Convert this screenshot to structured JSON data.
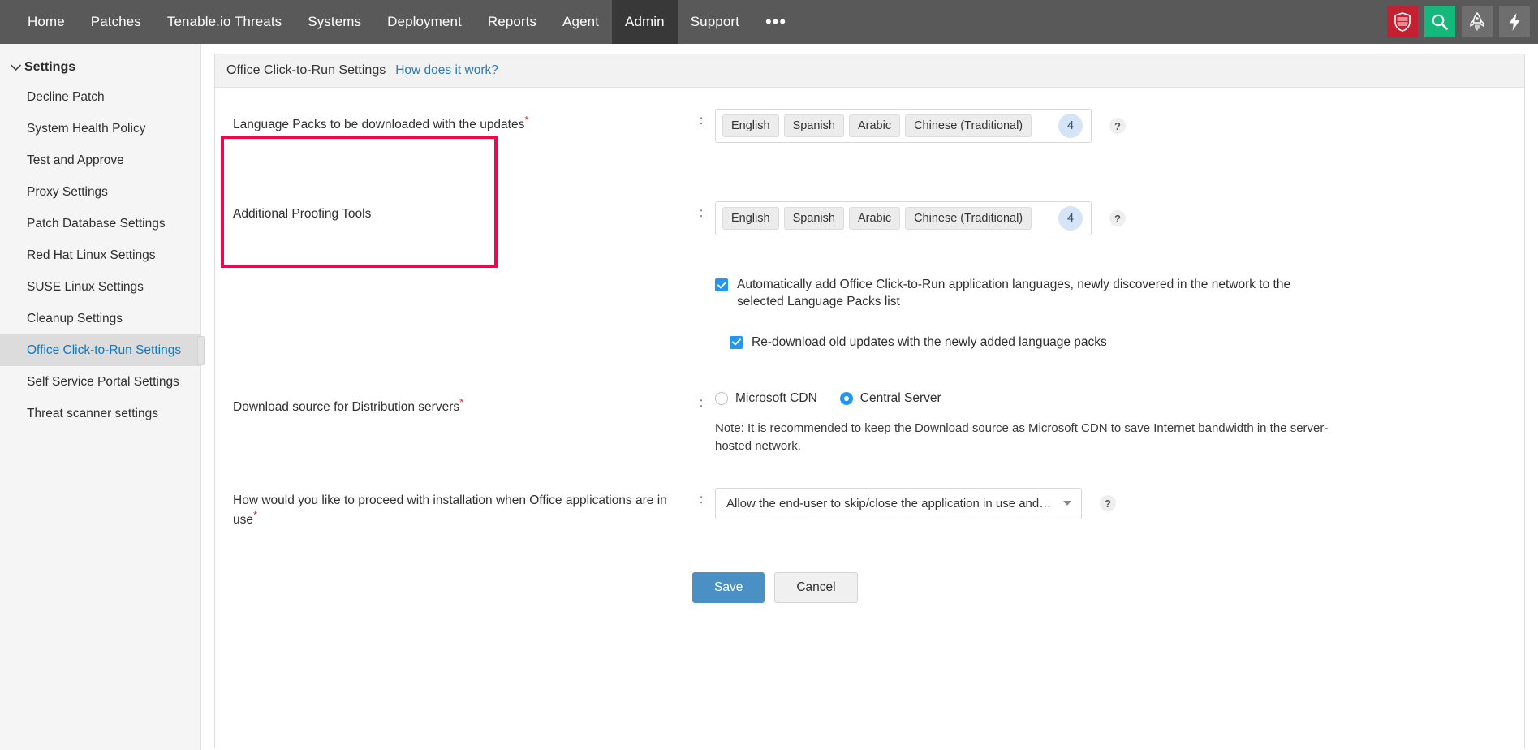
{
  "topnav": {
    "items": [
      {
        "label": "Home",
        "active": false
      },
      {
        "label": "Patches",
        "active": false
      },
      {
        "label": "Tenable.io Threats",
        "active": false
      },
      {
        "label": "Systems",
        "active": false
      },
      {
        "label": "Deployment",
        "active": false
      },
      {
        "label": "Reports",
        "active": false
      },
      {
        "label": "Agent",
        "active": false
      },
      {
        "label": "Admin",
        "active": true
      },
      {
        "label": "Support",
        "active": false
      }
    ],
    "more_label": "•••",
    "icons": [
      {
        "name": "shield-icon",
        "color": "#c42032"
      },
      {
        "name": "search-icon",
        "color": "#13b87a"
      },
      {
        "name": "rocket-icon",
        "color": "#6e6e6e"
      },
      {
        "name": "bolt-icon",
        "color": "#6e6e6e"
      }
    ]
  },
  "sidebar": {
    "header": "Settings",
    "items": [
      {
        "label": "Decline Patch"
      },
      {
        "label": "System Health Policy"
      },
      {
        "label": "Test and Approve"
      },
      {
        "label": "Proxy Settings"
      },
      {
        "label": "Patch Database Settings"
      },
      {
        "label": "Red Hat Linux Settings"
      },
      {
        "label": "SUSE Linux Settings"
      },
      {
        "label": "Cleanup Settings"
      },
      {
        "label": "Office Click-to-Run Settings"
      },
      {
        "label": "Self Service Portal Settings"
      },
      {
        "label": "Threat scanner settings"
      }
    ],
    "active_index": 8
  },
  "panel": {
    "title": "Office Click-to-Run Settings",
    "how_link": "How does it work?"
  },
  "form": {
    "colon": ":",
    "help_glyph": "?",
    "language_packs": {
      "label": "Language Packs to be downloaded with the updates",
      "required": "*",
      "tags": [
        "English",
        "Spanish",
        "Arabic",
        "Chinese (Traditional)"
      ],
      "count": "4"
    },
    "proofing_tools": {
      "label": "Additional Proofing Tools",
      "tags": [
        "English",
        "Spanish",
        "Arabic",
        "Chinese (Traditional)"
      ],
      "count": "4"
    },
    "auto_add_checkbox": {
      "label": "Automatically add Office Click-to-Run application languages, newly discovered in the network to the selected Language Packs list",
      "checked": true
    },
    "redownload_checkbox": {
      "label": "Re-download old updates with the newly added language packs",
      "checked": true
    },
    "download_source": {
      "label": "Download source for Distribution servers",
      "required": "*",
      "options": [
        {
          "label": "Microsoft CDN",
          "selected": false
        },
        {
          "label": "Central Server",
          "selected": true
        }
      ],
      "note": "Note: It is recommended to keep the Download source as Microsoft CDN to save Internet bandwidth in the server-hosted network."
    },
    "install_behavior": {
      "label": "How would you like to proceed with installation when Office applications are in use",
      "required": "*",
      "selected_value": "Allow the end-user to skip/close the application in use and proceed w..."
    }
  },
  "actions": {
    "save_label": "Save",
    "cancel_label": "Cancel"
  }
}
